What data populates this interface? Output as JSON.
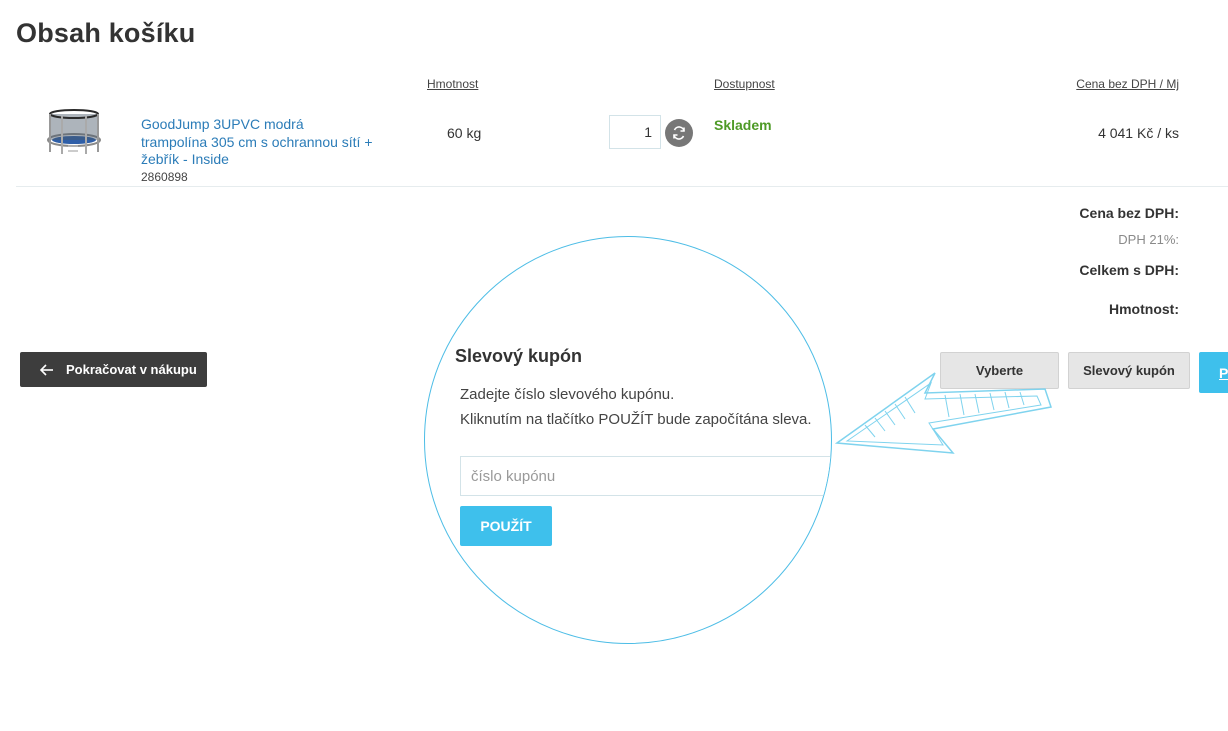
{
  "page": {
    "title": "Obsah košíku"
  },
  "columns": {
    "weight": "Hmotnost",
    "availability": "Dostupnost",
    "price": "Cena bez DPH / Mj"
  },
  "product": {
    "name": "GoodJump 3UPVC modrá trampolína 305 cm s ochrannou sítí + žebřík - Inside",
    "code": "2860898",
    "weight": "60 kg",
    "quantity": "1",
    "availability": "Skladem",
    "price": "4 041 Kč / ks",
    "image_icon": "trampoline-image"
  },
  "summary": {
    "price_without_vat": "Cena bez DPH:",
    "vat": "DPH 21%:",
    "total_with_vat": "Celkem s DPH:",
    "weight": "Hmotnost:"
  },
  "actions": {
    "continue_shopping": "Pokračovat v nákupu",
    "choose_partial": "Vyberte",
    "coupon_button": "Slevový kupón",
    "next_partial": "P"
  },
  "coupon": {
    "title": "Slevový kupón",
    "line1": "Zadejte číslo slevového kupónu.",
    "line2": "Kliknutím na tlačítko POUŽÍT bude započítána sleva.",
    "placeholder": "číslo kupónu",
    "apply": "POUŽÍT"
  },
  "colors": {
    "link": "#2b7cb8",
    "in_stock": "#4e9a26",
    "accent_blue": "#3ec0ec",
    "dark_button": "#3d3d3d",
    "highlight_outline": "#4dbde6"
  }
}
